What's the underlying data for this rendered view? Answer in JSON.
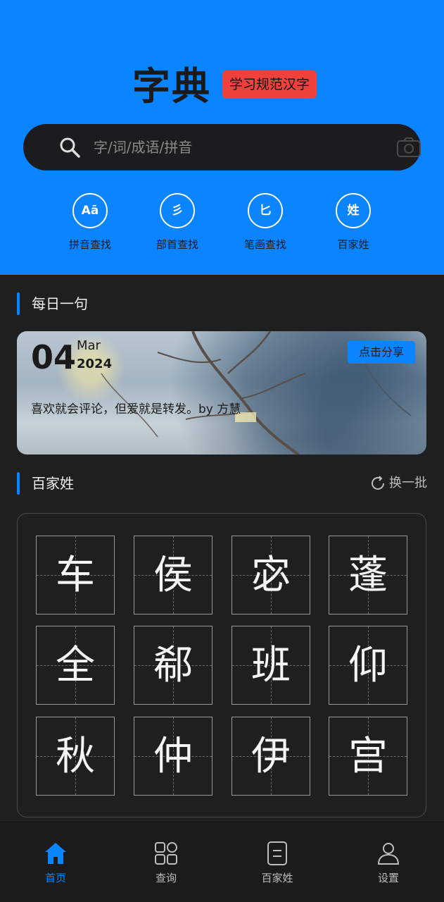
{
  "header": {
    "title": "字典",
    "tag": "学习规范汉字",
    "search_placeholder": "字/词/成语/拼音",
    "quick": [
      {
        "icon_text": "Aā",
        "label": "拼音查找",
        "icon": "pinyin-icon"
      },
      {
        "icon_text": "彡",
        "label": "部首查找",
        "icon": "radical-icon"
      },
      {
        "icon_text": "匕",
        "label": "笔画查找",
        "icon": "stroke-icon"
      },
      {
        "icon_text": "姓",
        "label": "百家姓",
        "icon": "surname-icon"
      }
    ]
  },
  "daily": {
    "section_title": "每日一句",
    "day": "04",
    "month": "Mar",
    "year": "2024",
    "share_label": "点击分享",
    "quote": "喜欢就会评论，但爱就是转发。by 方慧"
  },
  "surnames": {
    "section_title": "百家姓",
    "refresh_label": "换一批",
    "chars": [
      "车",
      "侯",
      "宓",
      "蓬",
      "全",
      "郗",
      "班",
      "仰",
      "秋",
      "仲",
      "伊",
      "宫"
    ]
  },
  "nav": {
    "items": [
      {
        "label": "首页",
        "active": true
      },
      {
        "label": "查询",
        "active": false
      },
      {
        "label": "百家姓",
        "active": false
      },
      {
        "label": "设置",
        "active": false
      }
    ]
  },
  "colors": {
    "accent": "#0a84ff",
    "tag_bg": "#f0423c",
    "background": "#1f1f1f"
  }
}
